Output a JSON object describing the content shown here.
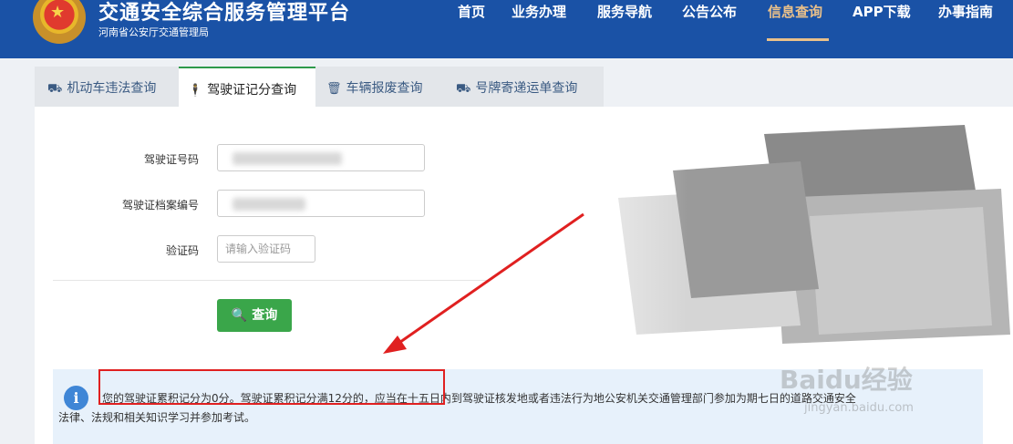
{
  "header": {
    "title": "交通安全综合服务管理平台",
    "subtitle": "河南省公安厅交通管理局",
    "emblem_icon": "police-emblem-icon"
  },
  "nav": {
    "items": [
      {
        "label": "首页"
      },
      {
        "label": "业务办理"
      },
      {
        "label": "服务导航"
      },
      {
        "label": "公告公布"
      },
      {
        "label": "信息查询",
        "active": true
      },
      {
        "label": "APP下载"
      },
      {
        "label": "办事指南"
      }
    ]
  },
  "tabs": [
    {
      "label": "机动车违法查询",
      "icon": "truck-icon"
    },
    {
      "label": "驾驶证记分查询",
      "icon": "person-icon",
      "active": true
    },
    {
      "label": "车辆报废查询",
      "icon": "trash-icon"
    },
    {
      "label": "号牌寄递运单查询",
      "icon": "truck-icon"
    }
  ],
  "form": {
    "license_label": "驾驶证号码",
    "file_label": "驾驶证档案编号",
    "captcha_label": "验证码",
    "captcha_placeholder": "请输入验证码",
    "query_label": "查询"
  },
  "info": {
    "line1": "您的驾驶证累积记分为0分。驾驶证累积记分满12分的，应当在十五日内到驾驶证核发地或者违法行为地公安机关交通管理部门参加为期七日的道路交通安全",
    "line2": "法律、法规和相关知识学习并参加考试。"
  },
  "watermark": {
    "brand": "Baidu经验",
    "url": "jingyan.baidu.com"
  },
  "colors": {
    "header_bg": "#1a52a6",
    "nav_active": "#e9c08a",
    "button_green": "#3aa64a",
    "info_bg": "#e7f1fb",
    "annotation_red": "#e02020"
  }
}
